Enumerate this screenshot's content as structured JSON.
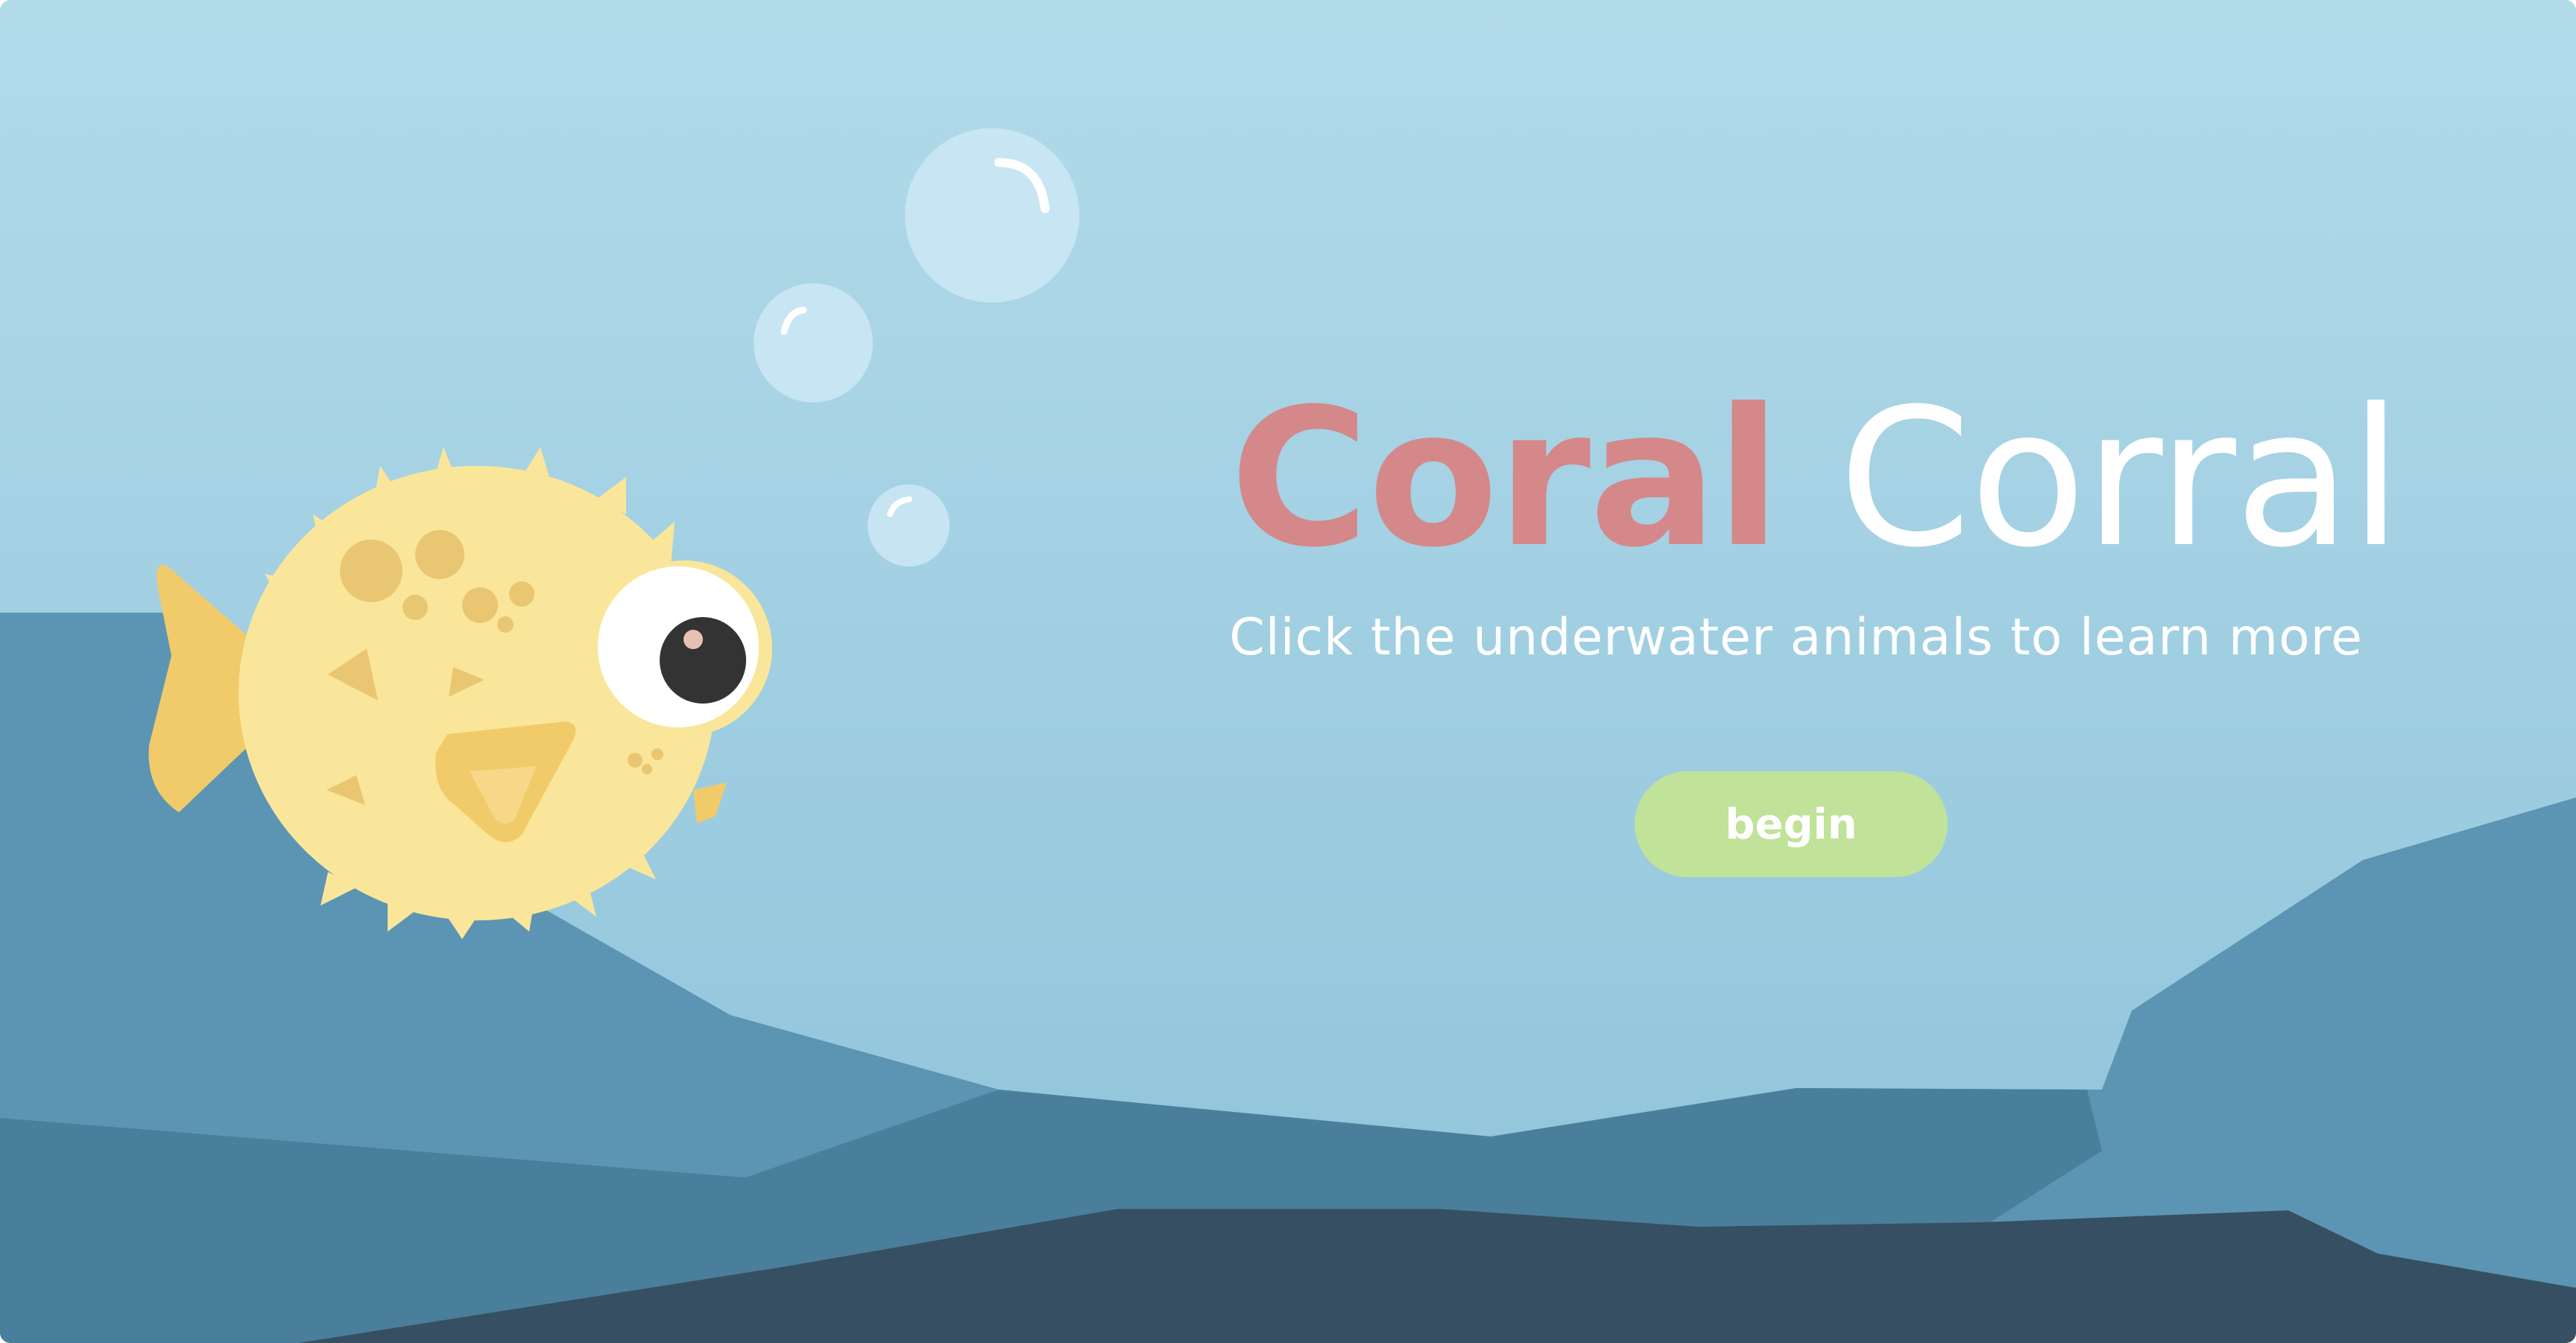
{
  "colors": {
    "sky_top": "#b2dbea",
    "sky_bottom": "#8ec2d9",
    "ridge_back": "#5b95b3",
    "ridge_mid": "#4a7f9c",
    "ridge_front": "#374f62",
    "title_accent": "#d4888a",
    "title_light": "#ffffff",
    "subtitle": "#ffffff",
    "button_bg": "#c1e299",
    "button_text": "#ffffff",
    "fish_body": "#fae69a",
    "fish_fin": "#f1cb69",
    "fish_spot": "#e9c772",
    "fish_eye_white": "#ffffff",
    "fish_pupil": "#333333",
    "fish_pupil_highlight": "#e8c0b3",
    "bubble_fill": "#cce8f4"
  },
  "title": {
    "word1": "Coral",
    "word2": "Corral"
  },
  "subtitle": "Click the underwater animals to learn more",
  "begin_button": {
    "label": "begin"
  },
  "icons": {
    "fish": "pufferfish-icon",
    "bubble": "bubble-icon"
  }
}
